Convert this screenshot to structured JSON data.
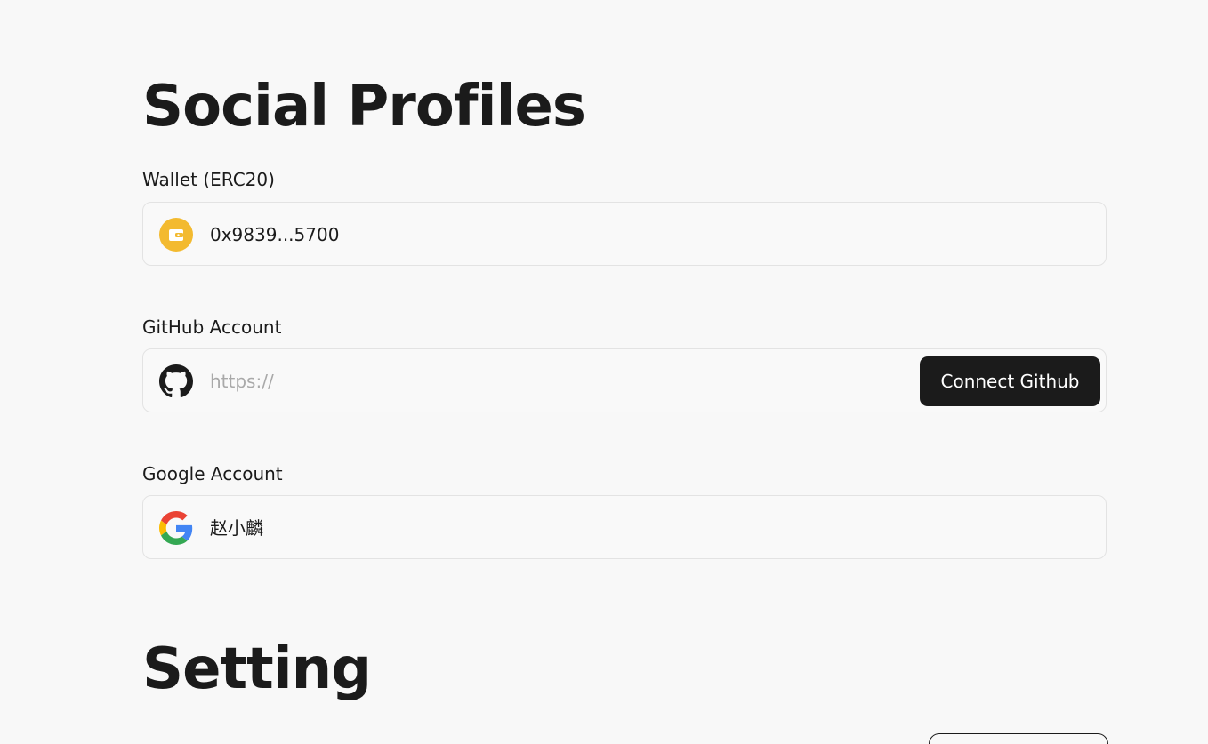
{
  "sections": {
    "social_title": "Social Profiles",
    "setting_title": "Setting"
  },
  "wallet": {
    "label": "Wallet (ERC20)",
    "value": "0x9839...5700",
    "icon": "wallet-icon",
    "icon_color": "#F3BA2F"
  },
  "github": {
    "label": "GitHub Account",
    "placeholder": "https://",
    "value": "",
    "icon": "github-icon",
    "button_label": "Connect Github"
  },
  "google": {
    "label": "Google Account",
    "value": "赵小麟",
    "icon": "google-icon"
  },
  "colors": {
    "background": "#F8F8F8",
    "primary_button": "#1B1B1B",
    "border": "#E3E3E3"
  }
}
